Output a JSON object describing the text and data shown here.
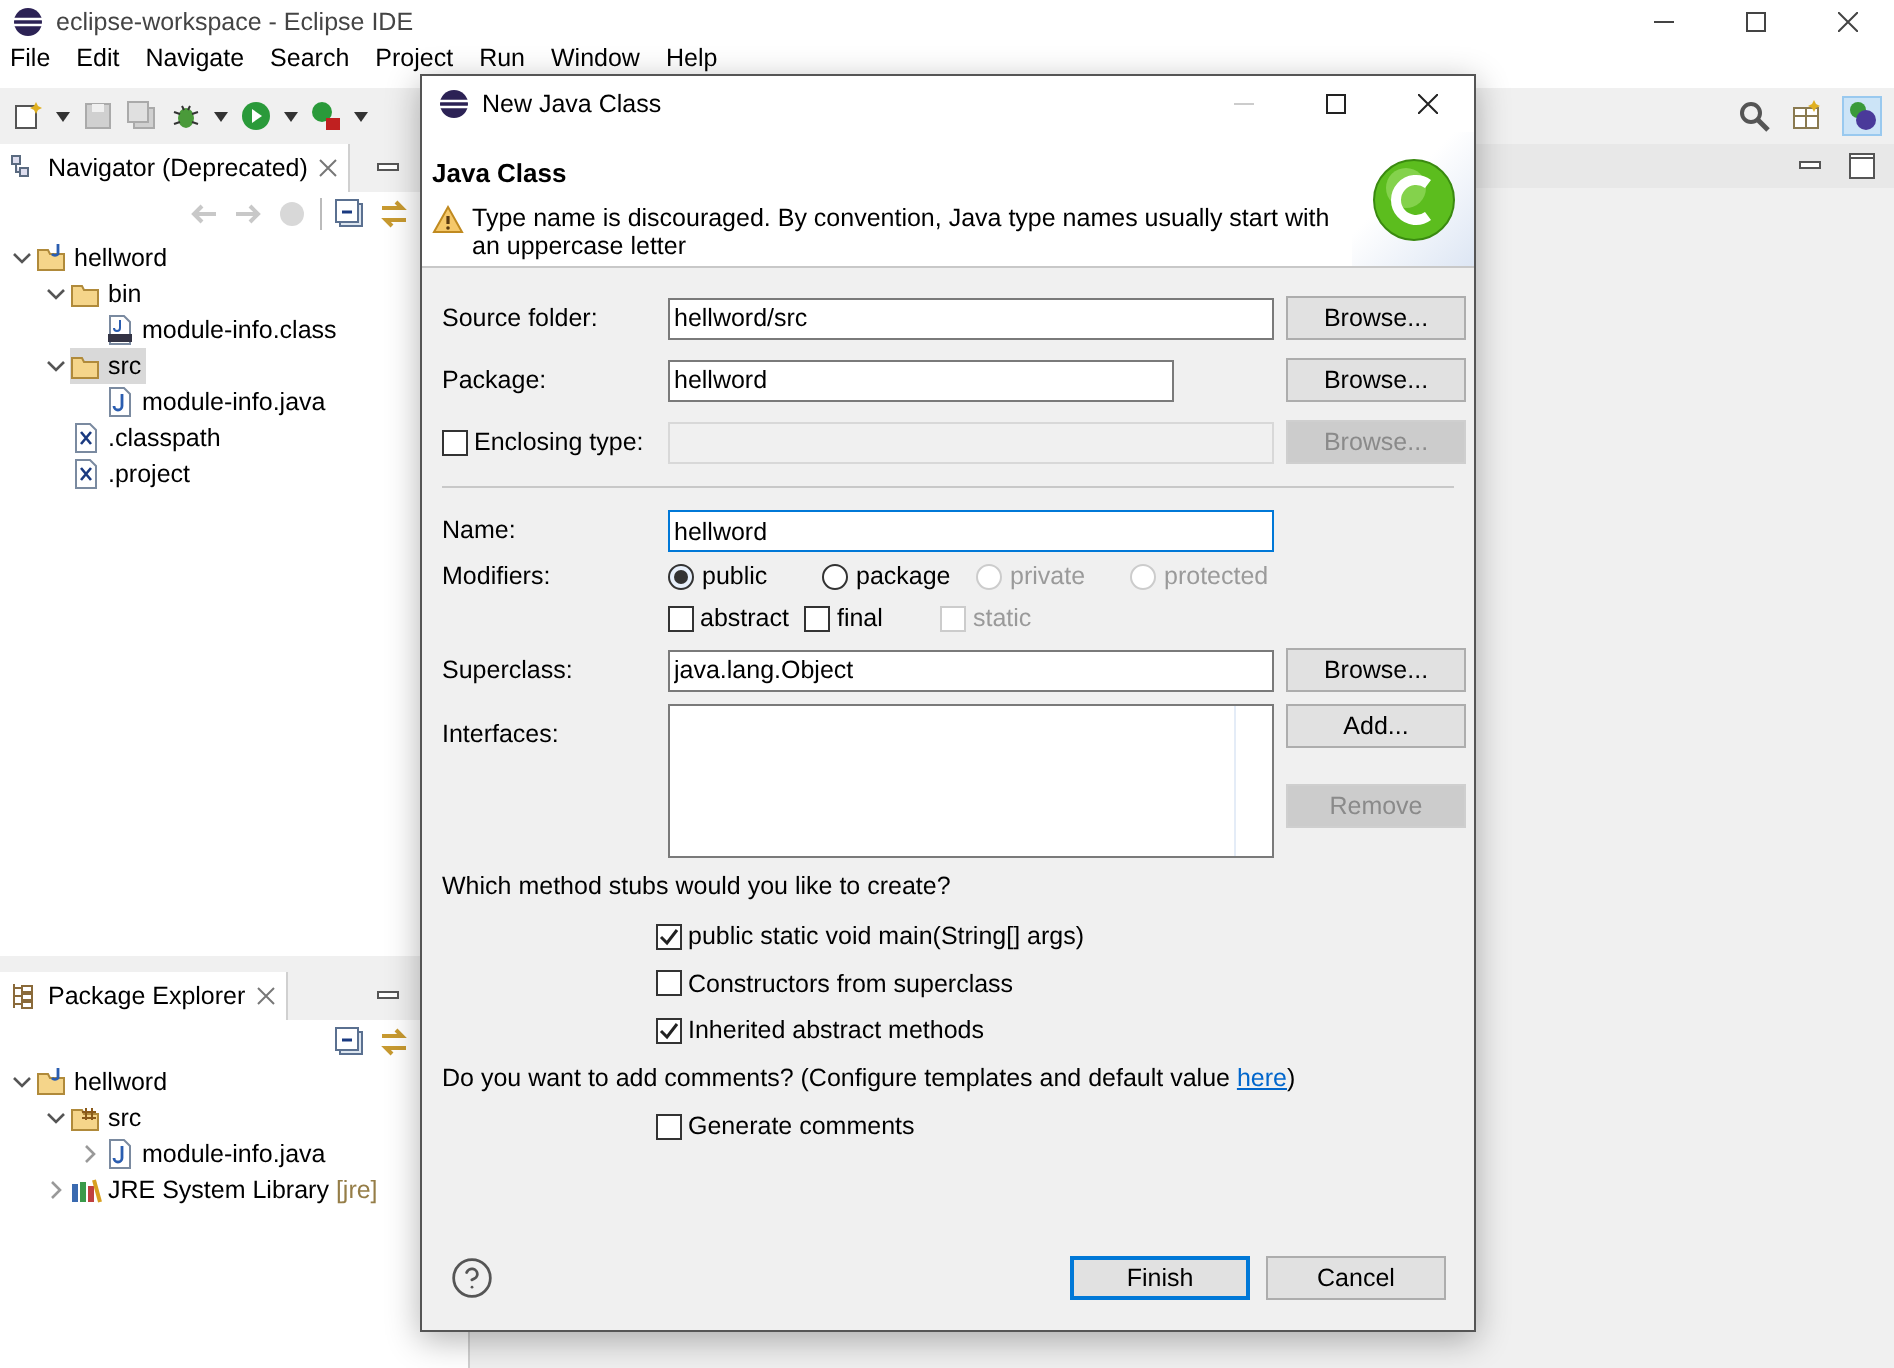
{
  "window": {
    "title": "eclipse-workspace - Eclipse IDE"
  },
  "menu": [
    "File",
    "Edit",
    "Navigate",
    "Search",
    "Project",
    "Run",
    "Window",
    "Help"
  ],
  "navigator": {
    "title": "Navigator (Deprecated)",
    "tree": [
      {
        "label": "hellword",
        "kind": "project",
        "expanded": true,
        "selected": false,
        "children": [
          {
            "label": "bin",
            "kind": "folder",
            "expanded": true,
            "selected": false,
            "children": [
              {
                "label": "module-info.class",
                "kind": "classfile",
                "selected": false
              }
            ]
          },
          {
            "label": "src",
            "kind": "folder",
            "expanded": true,
            "selected": true,
            "children": [
              {
                "label": "module-info.java",
                "kind": "javafile",
                "selected": false
              }
            ]
          },
          {
            "label": ".classpath",
            "kind": "xmlfile",
            "selected": false
          },
          {
            "label": ".project",
            "kind": "xmlfile",
            "selected": false
          }
        ]
      }
    ]
  },
  "package_explorer": {
    "title": "Package Explorer",
    "tree": [
      {
        "label": "hellword",
        "kind": "project",
        "expanded": true,
        "selected": false,
        "children": [
          {
            "label": "src",
            "kind": "package",
            "expanded": true,
            "selected": false,
            "children": [
              {
                "label": "module-info.java",
                "kind": "javafile",
                "expanded": false,
                "selected": false
              }
            ]
          },
          {
            "label": "JRE System Library",
            "decoration": "[jre]",
            "kind": "library",
            "expanded": false,
            "selected": false
          }
        ]
      }
    ]
  },
  "dialog": {
    "title": "New Java Class",
    "heading": "Java Class",
    "message": "Type name is discouraged. By convention, Java type names usually start with an uppercase letter",
    "source_folder": {
      "label": "Source folder:",
      "value": "hellword/src",
      "button": {
        "label": "Browse...",
        "disabled": false
      }
    },
    "package": {
      "label": "Package:",
      "value": "hellword",
      "button": {
        "label": "Browse...",
        "disabled": false
      }
    },
    "enclosing_type": {
      "label": "Enclosing type:",
      "checked": false,
      "button": {
        "label": "Browse...",
        "disabled": true
      }
    },
    "name": {
      "label": "Name:",
      "value": "hellword",
      "focused": true
    },
    "modifiers": {
      "label": "Modifiers:",
      "options": [
        {
          "label": "public",
          "selected": true,
          "disabled": false
        },
        {
          "label": "package",
          "selected": false,
          "disabled": false
        },
        {
          "label": "private",
          "selected": false,
          "disabled": true
        },
        {
          "label": "protected",
          "selected": false,
          "disabled": true
        }
      ],
      "flags": [
        {
          "label": "abstract",
          "checked": false,
          "disabled": false
        },
        {
          "label": "final",
          "checked": false,
          "disabled": false
        },
        {
          "label": "static",
          "checked": false,
          "disabled": true
        }
      ]
    },
    "superclass": {
      "label": "Superclass:",
      "value": "java.lang.Object",
      "button": {
        "label": "Browse...",
        "disabled": false
      }
    },
    "interfaces": {
      "label": "Interfaces:",
      "buttons": [
        {
          "label": "Add...",
          "disabled": false
        },
        {
          "label": "Remove",
          "disabled": true
        }
      ]
    },
    "stubs": {
      "question": "Which method stubs would you like to create?",
      "options": [
        {
          "label": "public static void main(String[] args)",
          "checked": true
        },
        {
          "label": "Constructors from superclass",
          "checked": false
        },
        {
          "label": "Inherited abstract methods",
          "checked": true
        }
      ]
    },
    "comments": {
      "question": "Do you want to add comments? (Configure templates and default value ",
      "link": "here",
      "suffix": ")",
      "options": [
        {
          "label": "Generate comments",
          "checked": false
        }
      ]
    },
    "buttons": [
      {
        "label": "Finish",
        "default": true
      },
      {
        "label": "Cancel",
        "default": false
      }
    ]
  }
}
